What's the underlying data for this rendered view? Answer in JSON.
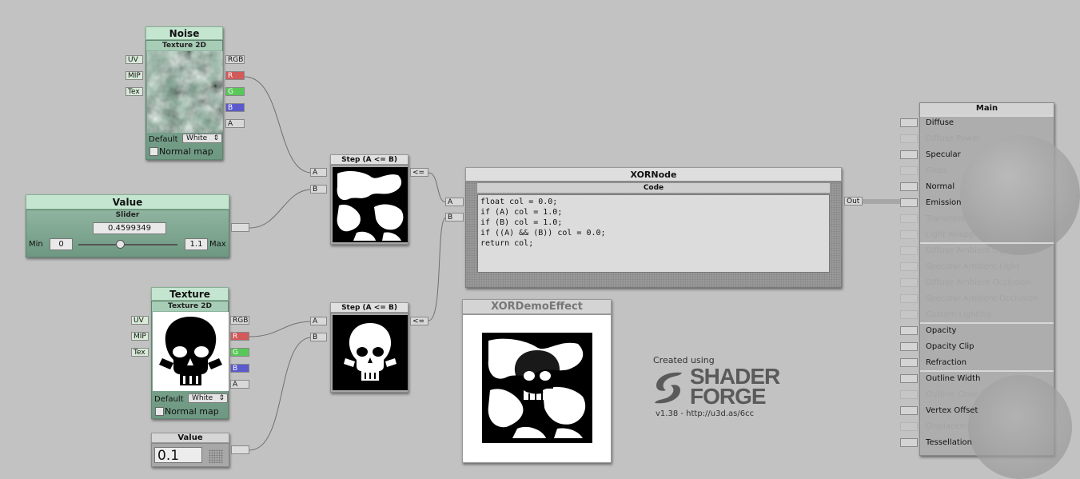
{
  "noise_node": {
    "title": "Noise",
    "subtitle": "Texture 2D",
    "inputs": [
      "UV",
      "MIP",
      "Tex"
    ],
    "outputs": [
      "RGB",
      "R",
      "G",
      "B",
      "A"
    ],
    "default_label": "Default",
    "default_value": "White",
    "normal_map_label": "Normal map",
    "normal_map_checked": false
  },
  "value_slider_node": {
    "title": "Value",
    "subtitle": "Slider",
    "value": "0.4599349",
    "min_label": "Min",
    "min_value": "0",
    "max_value": "1.1",
    "max_label": "Max",
    "slider_fraction": 0.418
  },
  "texture_node": {
    "title": "Texture",
    "subtitle": "Texture 2D",
    "inputs": [
      "UV",
      "MIP",
      "Tex"
    ],
    "outputs": [
      "RGB",
      "R",
      "G",
      "B",
      "A"
    ],
    "default_label": "Default",
    "default_value": "White",
    "normal_map_label": "Normal map",
    "normal_map_checked": false
  },
  "value_node": {
    "title": "Value",
    "value": "0.1"
  },
  "step_node_top": {
    "title": "Step (A <= B)",
    "inputs": [
      "A",
      "B"
    ],
    "output": "<="
  },
  "step_node_bottom": {
    "title": "Step (A <= B)",
    "inputs": [
      "A",
      "B"
    ],
    "output": "<="
  },
  "xor_node": {
    "title": "XORNode",
    "subtitle": "Code",
    "inputs": [
      "A",
      "B"
    ],
    "output": "Out",
    "code": "float col = 0.0;\nif (A) col = 1.0;\nif (B) col = 1.0;\nif ((A) && (B)) col = 0.0;\nreturn col;"
  },
  "preview": {
    "title": "XORDemoEffect"
  },
  "branding": {
    "created_using": "Created using",
    "logo_line1": "SHADER",
    "logo_line2": "FORGE",
    "version": "v1.38 - http://u3d.as/6cc"
  },
  "main_node": {
    "title": "Main",
    "inputs": [
      {
        "label": "Diffuse",
        "enabled": true
      },
      {
        "label": "Diffuse Power",
        "enabled": false
      },
      {
        "label": "Specular",
        "enabled": true
      },
      {
        "label": "Gloss",
        "enabled": false
      },
      {
        "label": "Normal",
        "enabled": true
      },
      {
        "label": "Emission",
        "enabled": true
      },
      {
        "label": "Transmission",
        "enabled": false
      },
      {
        "label": "Light Wrapping",
        "enabled": false
      },
      {
        "label": "Diffuse Ambient Light",
        "enabled": false
      },
      {
        "label": "Specular Ambient Light",
        "enabled": false
      },
      {
        "label": "Diffuse Ambient Occlusion",
        "enabled": false
      },
      {
        "label": "Specular Ambient Occlusion",
        "enabled": false
      },
      {
        "label": "Custom Lighting",
        "enabled": false
      },
      {
        "label": "Opacity",
        "enabled": true
      },
      {
        "label": "Opacity Clip",
        "enabled": true
      },
      {
        "label": "Refraction",
        "enabled": true
      },
      {
        "label": "Outline Width",
        "enabled": true
      },
      {
        "label": "Outline Color",
        "enabled": false
      },
      {
        "label": "Vertex Offset",
        "enabled": true
      },
      {
        "label": "Displacement",
        "enabled": false
      },
      {
        "label": "Tessellation",
        "enabled": true
      }
    ]
  },
  "colors": {
    "canvas": "#c2c2c2",
    "node_green": "#8fb4a0",
    "port_r": "#d25a5a",
    "port_g": "#58c858",
    "port_b": "#5a5acc"
  }
}
